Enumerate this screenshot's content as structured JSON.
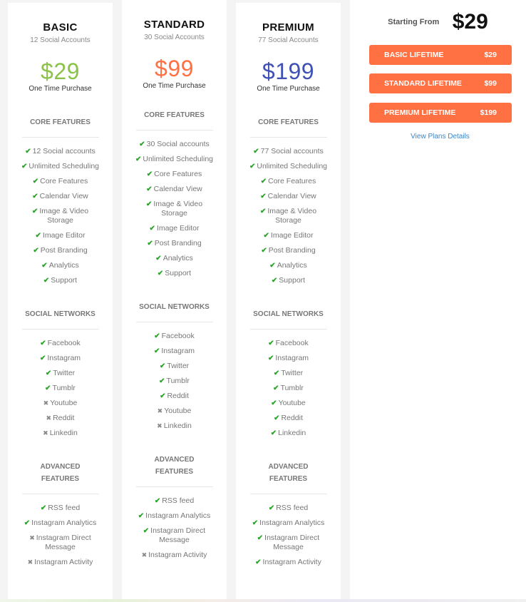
{
  "plans": [
    {
      "name": "BASIC",
      "accounts": "12 Social Accounts",
      "price": "$29",
      "price_color": "#8bc34a",
      "note": "One Time Purchase",
      "sections": [
        {
          "title": "CORE FEATURES",
          "items": [
            {
              "label": "12 Social accounts",
              "included": true
            },
            {
              "label": "Unlimited Scheduling",
              "included": true
            },
            {
              "label": "Core Features",
              "included": true
            },
            {
              "label": "Calendar View",
              "included": true
            },
            {
              "label": "Image & Video Storage",
              "included": true
            },
            {
              "label": "Image Editor",
              "included": true
            },
            {
              "label": "Post Branding",
              "included": true
            },
            {
              "label": "Analytics",
              "included": true
            },
            {
              "label": "Support",
              "included": true
            }
          ]
        },
        {
          "title": "SOCIAL NETWORKS",
          "items": [
            {
              "label": "Facebook",
              "included": true
            },
            {
              "label": "Instagram",
              "included": true
            },
            {
              "label": "Twitter",
              "included": true
            },
            {
              "label": "Tumblr",
              "included": true
            },
            {
              "label": "Youtube",
              "included": false
            },
            {
              "label": "Reddit",
              "included": false
            },
            {
              "label": "Linkedin",
              "included": false
            }
          ]
        },
        {
          "title": "ADVANCED FEATURES",
          "items": [
            {
              "label": "RSS feed",
              "included": true
            },
            {
              "label": "Instagram Analytics",
              "included": true
            },
            {
              "label": "Instagram Direct Message",
              "included": false
            },
            {
              "label": "Instagram Activity",
              "included": false
            }
          ]
        }
      ]
    },
    {
      "name": "STANDARD",
      "accounts": "30 Social Accounts",
      "price": "$99",
      "price_color": "#ff7043",
      "note": "One Time Purchase",
      "sections": [
        {
          "title": "CORE FEATURES",
          "items": [
            {
              "label": "30 Social accounts",
              "included": true
            },
            {
              "label": "Unlimited Scheduling",
              "included": true
            },
            {
              "label": "Core Features",
              "included": true
            },
            {
              "label": "Calendar View",
              "included": true
            },
            {
              "label": "Image & Video Storage",
              "included": true
            },
            {
              "label": "Image Editor",
              "included": true
            },
            {
              "label": "Post Branding",
              "included": true
            },
            {
              "label": "Analytics",
              "included": true
            },
            {
              "label": "Support",
              "included": true
            }
          ]
        },
        {
          "title": "SOCIAL NETWORKS",
          "items": [
            {
              "label": "Facebook",
              "included": true
            },
            {
              "label": "Instagram",
              "included": true
            },
            {
              "label": "Twitter",
              "included": true
            },
            {
              "label": "Tumblr",
              "included": true
            },
            {
              "label": "Reddit",
              "included": true
            },
            {
              "label": "Youtube",
              "included": false
            },
            {
              "label": "Linkedin",
              "included": false
            }
          ]
        },
        {
          "title": "ADVANCED FEATURES",
          "items": [
            {
              "label": "RSS feed",
              "included": true
            },
            {
              "label": "Instagram Analytics",
              "included": true
            },
            {
              "label": "Instagram Direct Message",
              "included": true
            },
            {
              "label": "Instagram Activity",
              "included": false
            }
          ]
        }
      ]
    },
    {
      "name": "PREMIUM",
      "accounts": "77 Social Accounts",
      "price": "$199",
      "price_color": "#3f51b5",
      "note": "One Time Purchase",
      "sections": [
        {
          "title": "CORE FEATURES",
          "items": [
            {
              "label": "77 Social accounts",
              "included": true
            },
            {
              "label": "Unlimited Scheduling",
              "included": true
            },
            {
              "label": "Core Features",
              "included": true
            },
            {
              "label": "Calendar View",
              "included": true
            },
            {
              "label": "Image & Video Storage",
              "included": true
            },
            {
              "label": "Image Editor",
              "included": true
            },
            {
              "label": "Post Branding",
              "included": true
            },
            {
              "label": "Analytics",
              "included": true
            },
            {
              "label": "Support",
              "included": true
            }
          ]
        },
        {
          "title": "SOCIAL NETWORKS",
          "items": [
            {
              "label": "Facebook",
              "included": true
            },
            {
              "label": "Instagram",
              "included": true
            },
            {
              "label": "Twitter",
              "included": true
            },
            {
              "label": "Tumblr",
              "included": true
            },
            {
              "label": "Youtube",
              "included": true
            },
            {
              "label": "Reddit",
              "included": true
            },
            {
              "label": "Linkedin",
              "included": true
            }
          ]
        },
        {
          "title": "ADVANCED FEATURES",
          "items": [
            {
              "label": "RSS feed",
              "included": true
            },
            {
              "label": "Instagram Analytics",
              "included": true
            },
            {
              "label": "Instagram Direct Message",
              "included": true
            },
            {
              "label": "Instagram Activity",
              "included": true
            }
          ]
        }
      ]
    }
  ],
  "icons": {
    "included": "check-icon",
    "excluded": "x-icon",
    "included_glyph": "✔",
    "excluded_glyph": "✖"
  },
  "colors": {
    "check": "#2aa62a",
    "cta": "#ff7043",
    "link": "#3a86c9"
  },
  "sidebar": {
    "starting_label": "Starting From",
    "starting_price": "$29",
    "lifetime_buttons": [
      {
        "label": "BASIC LIFETIME",
        "price": "$29"
      },
      {
        "label": "STANDARD LIFETIME",
        "price": "$99"
      },
      {
        "label": "PREMIUM LIFETIME",
        "price": "$199"
      }
    ],
    "view_details": "View Plans Details"
  }
}
